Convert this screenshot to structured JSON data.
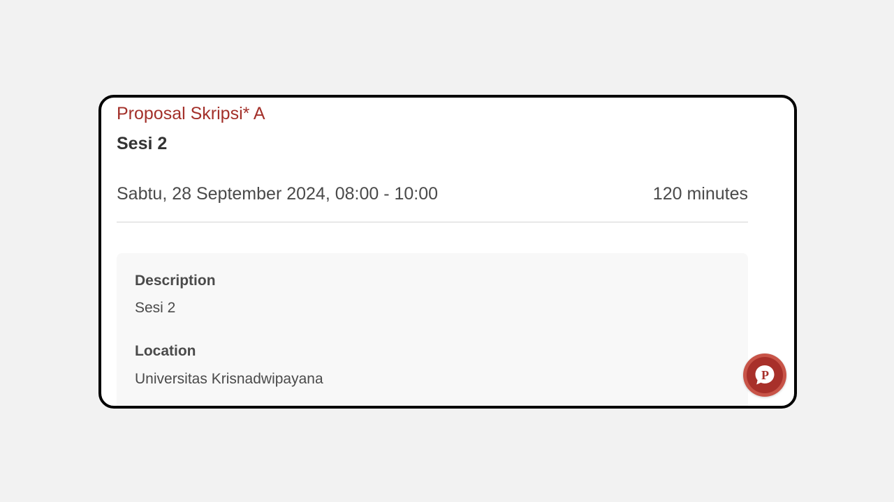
{
  "card": {
    "course_title": "Proposal Skripsi* A",
    "session_title": "Sesi 2",
    "datetime": "Sabtu, 28 September 2024, 08:00 - 10:00",
    "duration": "120 minutes",
    "details": {
      "description_label": "Description",
      "description_value": "Sesi 2",
      "location_label": "Location",
      "location_value": "Universitas Krisnadwipayana"
    }
  },
  "fab": {
    "icon": "chat-p-icon",
    "letter": "P"
  },
  "colors": {
    "accent": "#a3302a",
    "fab_outer": "#c85448",
    "fab_inner": "#a8302a",
    "panel_bg": "#f8f8f8",
    "page_bg": "#f2f2f2"
  }
}
